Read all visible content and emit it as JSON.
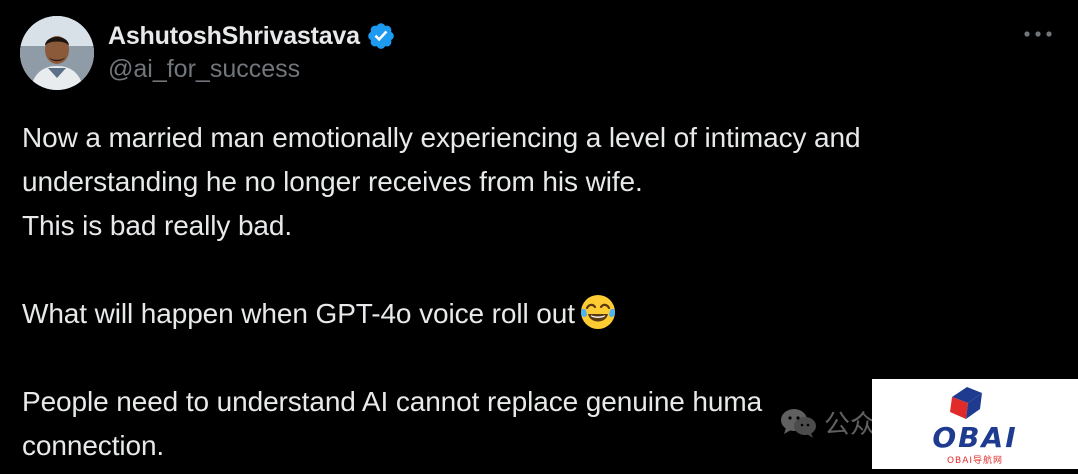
{
  "author": {
    "display_name": "AshutoshShrivastava",
    "handle": "@ai_for_success",
    "verified": true,
    "avatar_icon": "user-avatar-photo"
  },
  "menu": {
    "more_icon": "more-horizontal-icon"
  },
  "tweet": {
    "lines": [
      "Now a married man emotionally experiencing a level of intimacy and",
      "understanding he no longer receives from his wife.",
      "This is bad really bad.",
      "",
      "What will happen when GPT-4o voice roll out",
      "",
      "People need to understand AI cannot replace genuine huma",
      "connection."
    ],
    "emoji": "face-with-tears-of-joy"
  },
  "watermark": {
    "wechat_icon": "wechat-icon",
    "text": "公众"
  },
  "logo": {
    "name": "OBAI",
    "subtitle": "OBAI导航网",
    "colors": {
      "navy": "#1f3b8f",
      "red": "#e12a2a"
    }
  },
  "colors": {
    "background": "#000000",
    "text": "#e7e9ea",
    "secondary": "#71767b",
    "verified": "#1d9bf0"
  }
}
